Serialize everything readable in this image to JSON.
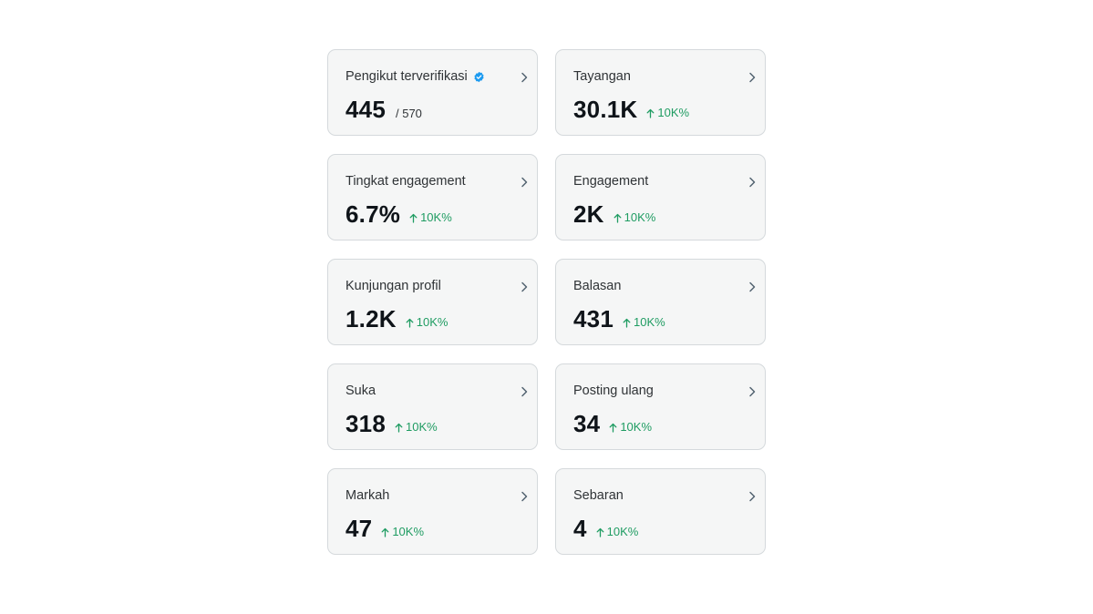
{
  "cards": [
    {
      "label": "Pengikut terverifikasi",
      "value": "445",
      "sub": "/ 570",
      "change": "",
      "verified": true,
      "accent": "#1d9bf0"
    },
    {
      "label": "Tayangan",
      "value": "30.1K",
      "sub": "",
      "change": "10K%"
    },
    {
      "label": "Tingkat engagement",
      "value": "6.7%",
      "sub": "",
      "change": "10K%"
    },
    {
      "label": "Engagement",
      "value": "2K",
      "sub": "",
      "change": "10K%"
    },
    {
      "label": "Kunjungan profil",
      "value": "1.2K",
      "sub": "",
      "change": "10K%"
    },
    {
      "label": "Balasan",
      "value": "431",
      "sub": "",
      "change": "10K%"
    },
    {
      "label": "Suka",
      "value": "318",
      "sub": "",
      "change": "10K%"
    },
    {
      "label": "Posting ulang",
      "value": "34",
      "sub": "",
      "change": "10K%"
    },
    {
      "label": "Markah",
      "value": "47",
      "sub": "",
      "change": "10K%"
    },
    {
      "label": "Sebaran",
      "value": "4",
      "sub": "",
      "change": "10K%"
    }
  ],
  "icons": {
    "verified": "verified-badge-icon",
    "chevron": "chevron-right-icon",
    "change": "arrow-up-icon"
  },
  "colors": {
    "positive_change": "#1f9c62",
    "verified_badge": "#1d9bf0"
  }
}
